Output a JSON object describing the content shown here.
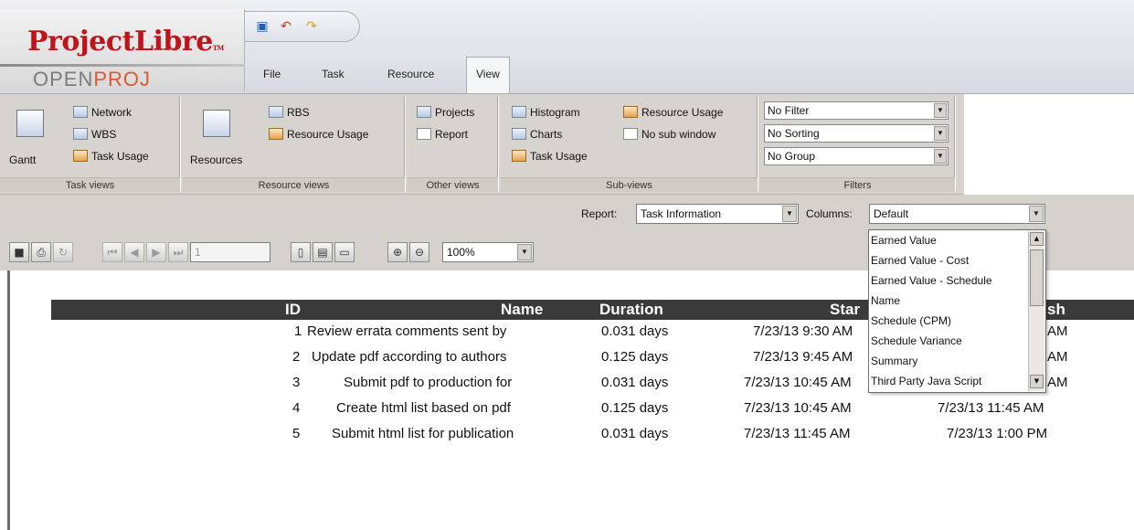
{
  "app": {
    "logo_main": "ProjectLibre",
    "logo_tm": "TM",
    "logo_sub_a": "OPEN",
    "logo_sub_b": "PROJ"
  },
  "quick_access": [
    "save-icon",
    "undo-icon",
    "redo-icon"
  ],
  "tabs": [
    {
      "label": "File"
    },
    {
      "label": "Task"
    },
    {
      "label": "Resource"
    },
    {
      "label": "View",
      "active": true
    }
  ],
  "ribbon": {
    "task_views": {
      "label": "Task views",
      "gantt": "Gantt",
      "network": "Network",
      "wbs": "WBS",
      "task_usage": "Task Usage"
    },
    "resource_views": {
      "label": "Resource views",
      "resources": "Resources",
      "rbs": "RBS",
      "resource_usage": "Resource Usage"
    },
    "other_views": {
      "label": "Other views",
      "projects": "Projects",
      "report": "Report"
    },
    "sub_views": {
      "label": "Sub-views",
      "histogram": "Histogram",
      "charts": "Charts",
      "task_usage": "Task Usage",
      "resource_usage": "Resource Usage",
      "no_sub_window": "No sub window"
    },
    "filters": {
      "label": "Filters",
      "filter": "No Filter",
      "sorting": "No Sorting",
      "group": "No Group"
    }
  },
  "report_bar": {
    "report_label": "Report:",
    "report_value": "Task Information",
    "columns_label": "Columns:",
    "columns_value": "Default"
  },
  "toolbar": {
    "page_value": "1",
    "zoom_value": "100%"
  },
  "columns_options": [
    "Earned Value",
    "Earned Value - Cost",
    "Earned Value - Schedule",
    "Name",
    "Schedule (CPM)",
    "Schedule Variance",
    "Summary",
    "Third Party Java Script"
  ],
  "table": {
    "headers": {
      "id": "ID",
      "name": "Name",
      "duration": "Duration",
      "start": "Star",
      "finish": "sh"
    },
    "rows": [
      {
        "id": "1",
        "name": "Review errata comments sent by",
        "duration": "0.031 days",
        "start": "7/23/13 9:30 AM",
        "finish": "AM"
      },
      {
        "id": "2",
        "name": "Update pdf according to authors",
        "duration": "0.125 days",
        "start": "7/23/13 9:45 AM",
        "finish": "AM"
      },
      {
        "id": "3",
        "name": "Submit pdf to production for",
        "duration": "0.031 days",
        "start": "7/23/13 10:45 AM",
        "finish": "AM"
      },
      {
        "id": "4",
        "name": "Create html list based on pdf",
        "duration": "0.125 days",
        "start": "7/23/13 10:45 AM",
        "finish": "7/23/13 11:45 AM"
      },
      {
        "id": "5",
        "name": "Submit html list for publication",
        "duration": "0.031 days",
        "start": "7/23/13 11:45 AM",
        "finish": "7/23/13 1:00 PM"
      }
    ]
  }
}
